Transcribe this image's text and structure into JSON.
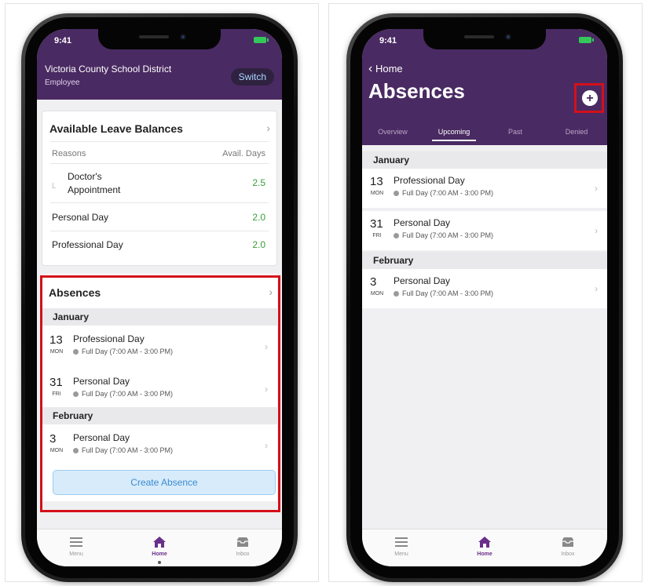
{
  "left_phone": {
    "status_time": "9:41",
    "district": "Victoria County School District",
    "role": "Employee",
    "switch_label": "Switch",
    "leave_panel": {
      "title": "Available Leave Balances",
      "col_reasons": "Reasons",
      "col_days": "Avail. Days",
      "rows": [
        {
          "reason_line1": "Doctor's",
          "reason_line2": "Appointment",
          "days": "2.5"
        },
        {
          "reason": "Personal Day",
          "days": "2.0"
        },
        {
          "reason": "Professional Day",
          "days": "2.0"
        }
      ]
    },
    "absences_panel": {
      "title": "Absences",
      "months": [
        "January",
        "February"
      ],
      "items": [
        {
          "day": "13",
          "dow": "MON",
          "title": "Professional Day",
          "detail": "Full Day (7:00 AM - 3:00 PM)"
        },
        {
          "day": "31",
          "dow": "FRI",
          "title": "Personal Day",
          "detail": "Full Day (7:00 AM - 3:00 PM)"
        },
        {
          "day": "3",
          "dow": "MON",
          "title": "Personal Day",
          "detail": "Full Day (7:00 AM - 3:00 PM)"
        }
      ],
      "create_label": "Create Absence"
    },
    "tabs": [
      {
        "label": "Menu",
        "icon": "menu-icon"
      },
      {
        "label": "Home",
        "icon": "home-icon",
        "active": true
      },
      {
        "label": "Inbox",
        "icon": "inbox-icon"
      }
    ]
  },
  "right_phone": {
    "status_time": "9:41",
    "back_label": "Home",
    "title": "Absences",
    "add_icon": "plus-circle-icon",
    "segments": [
      "Overview",
      "Upcoming",
      "Past",
      "Denied"
    ],
    "active_segment": "Upcoming",
    "months": [
      "January",
      "February"
    ],
    "items": [
      {
        "day": "13",
        "dow": "MON",
        "title": "Professional Day",
        "detail": "Full Day (7:00 AM - 3:00 PM)"
      },
      {
        "day": "31",
        "dow": "FRI",
        "title": "Personal Day",
        "detail": "Full Day (7:00 AM - 3:00 PM)"
      },
      {
        "day": "3",
        "dow": "MON",
        "title": "Personal Day",
        "detail": "Full Day (7:00 AM - 3:00 PM)"
      }
    ],
    "tabs": [
      {
        "label": "Menu",
        "icon": "menu-icon"
      },
      {
        "label": "Home",
        "icon": "home-icon",
        "active": true
      },
      {
        "label": "Inbox",
        "icon": "inbox-icon"
      }
    ]
  },
  "colors": {
    "header_purple": "#4a2a62",
    "highlight_red": "#d3101a",
    "balance_green": "#3a9e3a",
    "create_blue": "#3c8bd0",
    "active_tab": "#6a2f8a"
  }
}
